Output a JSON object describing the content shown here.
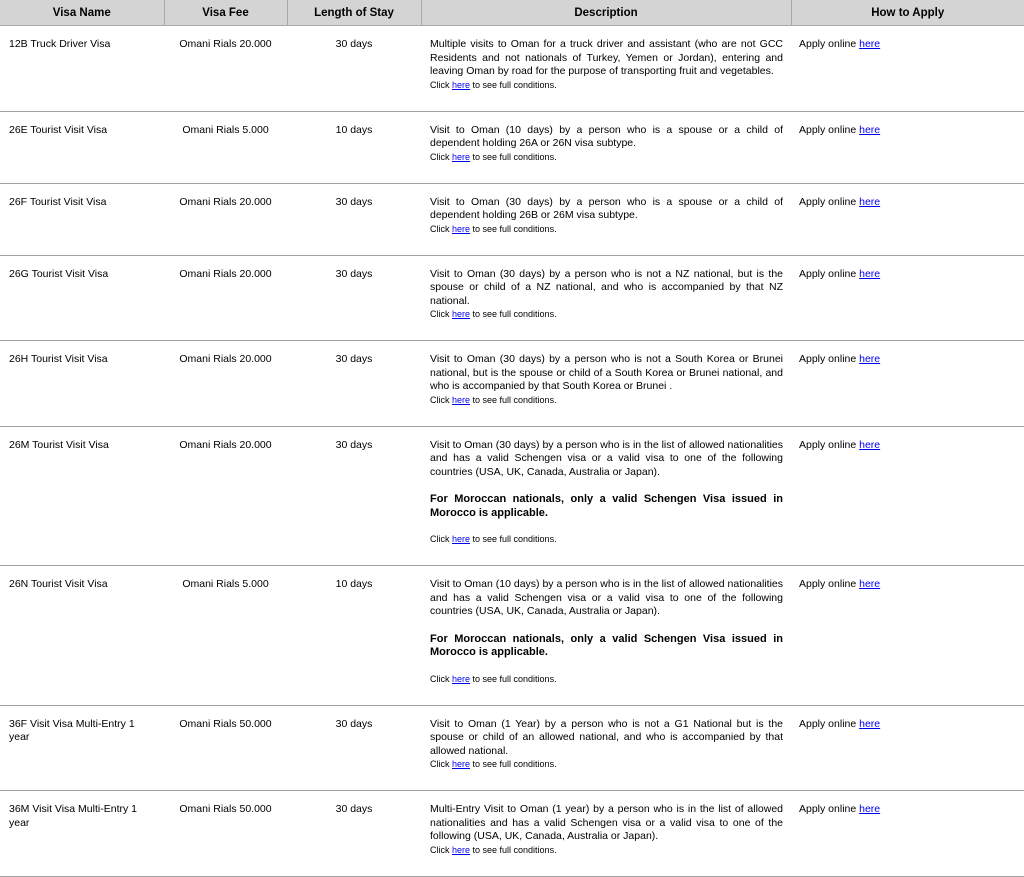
{
  "headers": [
    "Visa Name",
    "Visa Fee",
    "Length of Stay",
    "Description",
    "How to Apply"
  ],
  "link_text": "here",
  "condition_prefix": "Click ",
  "condition_suffix": " to see full conditions.",
  "apply_prefix": "Apply online ",
  "rows": [
    {
      "name": "12B Truck Driver Visa",
      "fee": "Omani Rials 20.000",
      "stay": "30 days",
      "description": "Multiple visits to Oman for a truck driver and assistant (who are not GCC Residents and not nationals of Turkey, Yemen or Jordan), entering and leaving Oman by road for the purpose of transporting fruit and vegetables.",
      "note": ""
    },
    {
      "name": "26E Tourist Visit Visa",
      "fee": "Omani Rials 5.000",
      "stay": "10 days",
      "description": "Visit to Oman (10 days) by a person who is a spouse or a child of dependent holding 26A or 26N visa subtype.",
      "note": ""
    },
    {
      "name": "26F Tourist Visit Visa",
      "fee": "Omani Rials 20.000",
      "stay": "30 days",
      "description": "Visit to Oman (30 days) by a person who is a spouse or a child of dependent holding 26B or 26M visa subtype.",
      "note": ""
    },
    {
      "name": "26G Tourist Visit Visa",
      "fee": "Omani Rials 20.000",
      "stay": "30 days",
      "description": "Visit to Oman (30 days) by a person who is not a NZ national, but is the spouse or child of a NZ national, and who is accompanied by that NZ national.",
      "note": ""
    },
    {
      "name": "26H Tourist Visit Visa",
      "fee": "Omani Rials 20.000",
      "stay": "30 days",
      "description": "Visit to Oman (30 days) by a person who is not a South Korea or Brunei national, but is the spouse or child of a South Korea or Brunei national, and who is accompanied by that South Korea or Brunei .",
      "note": ""
    },
    {
      "name": "26M Tourist Visit Visa",
      "fee": "Omani Rials 20.000",
      "stay": "30 days",
      "description": "Visit to Oman (30 days) by a person who is in the list of allowed nationalities and has a valid Schengen visa or a valid visa to one of the following countries (USA, UK, Canada, Australia or Japan).",
      "note": "For Moroccan nationals, only a valid Schengen Visa issued in Morocco is applicable."
    },
    {
      "name": "26N Tourist Visit Visa",
      "fee": "Omani Rials 5.000",
      "stay": "10 days",
      "description": "Visit to Oman (10 days) by a person who is in the list of allowed nationalities and has a valid Schengen visa or a valid visa to one of the following countries (USA, UK, Canada, Australia or Japan).",
      "note": "For Moroccan nationals, only a valid Schengen Visa issued in Morocco is applicable."
    },
    {
      "name": "36F Visit Visa Multi-Entry 1 year",
      "fee": "Omani Rials 50.000",
      "stay": "30 days",
      "description": "Visit to Oman (1 Year) by a person who is not a G1 National but is the spouse or child of an allowed national, and who is accompanied by that allowed national.",
      "note": ""
    },
    {
      "name": "36M Visit Visa Multi-Entry 1 year",
      "fee": "Omani Rials 50.000",
      "stay": "30 days",
      "description": "Multi-Entry Visit to Oman (1 year) by a person who is in the list of allowed nationalities and has a valid Schengen visa or a valid visa to one of the following (USA, UK, Canada, Australia or Japan).",
      "note": ""
    }
  ]
}
